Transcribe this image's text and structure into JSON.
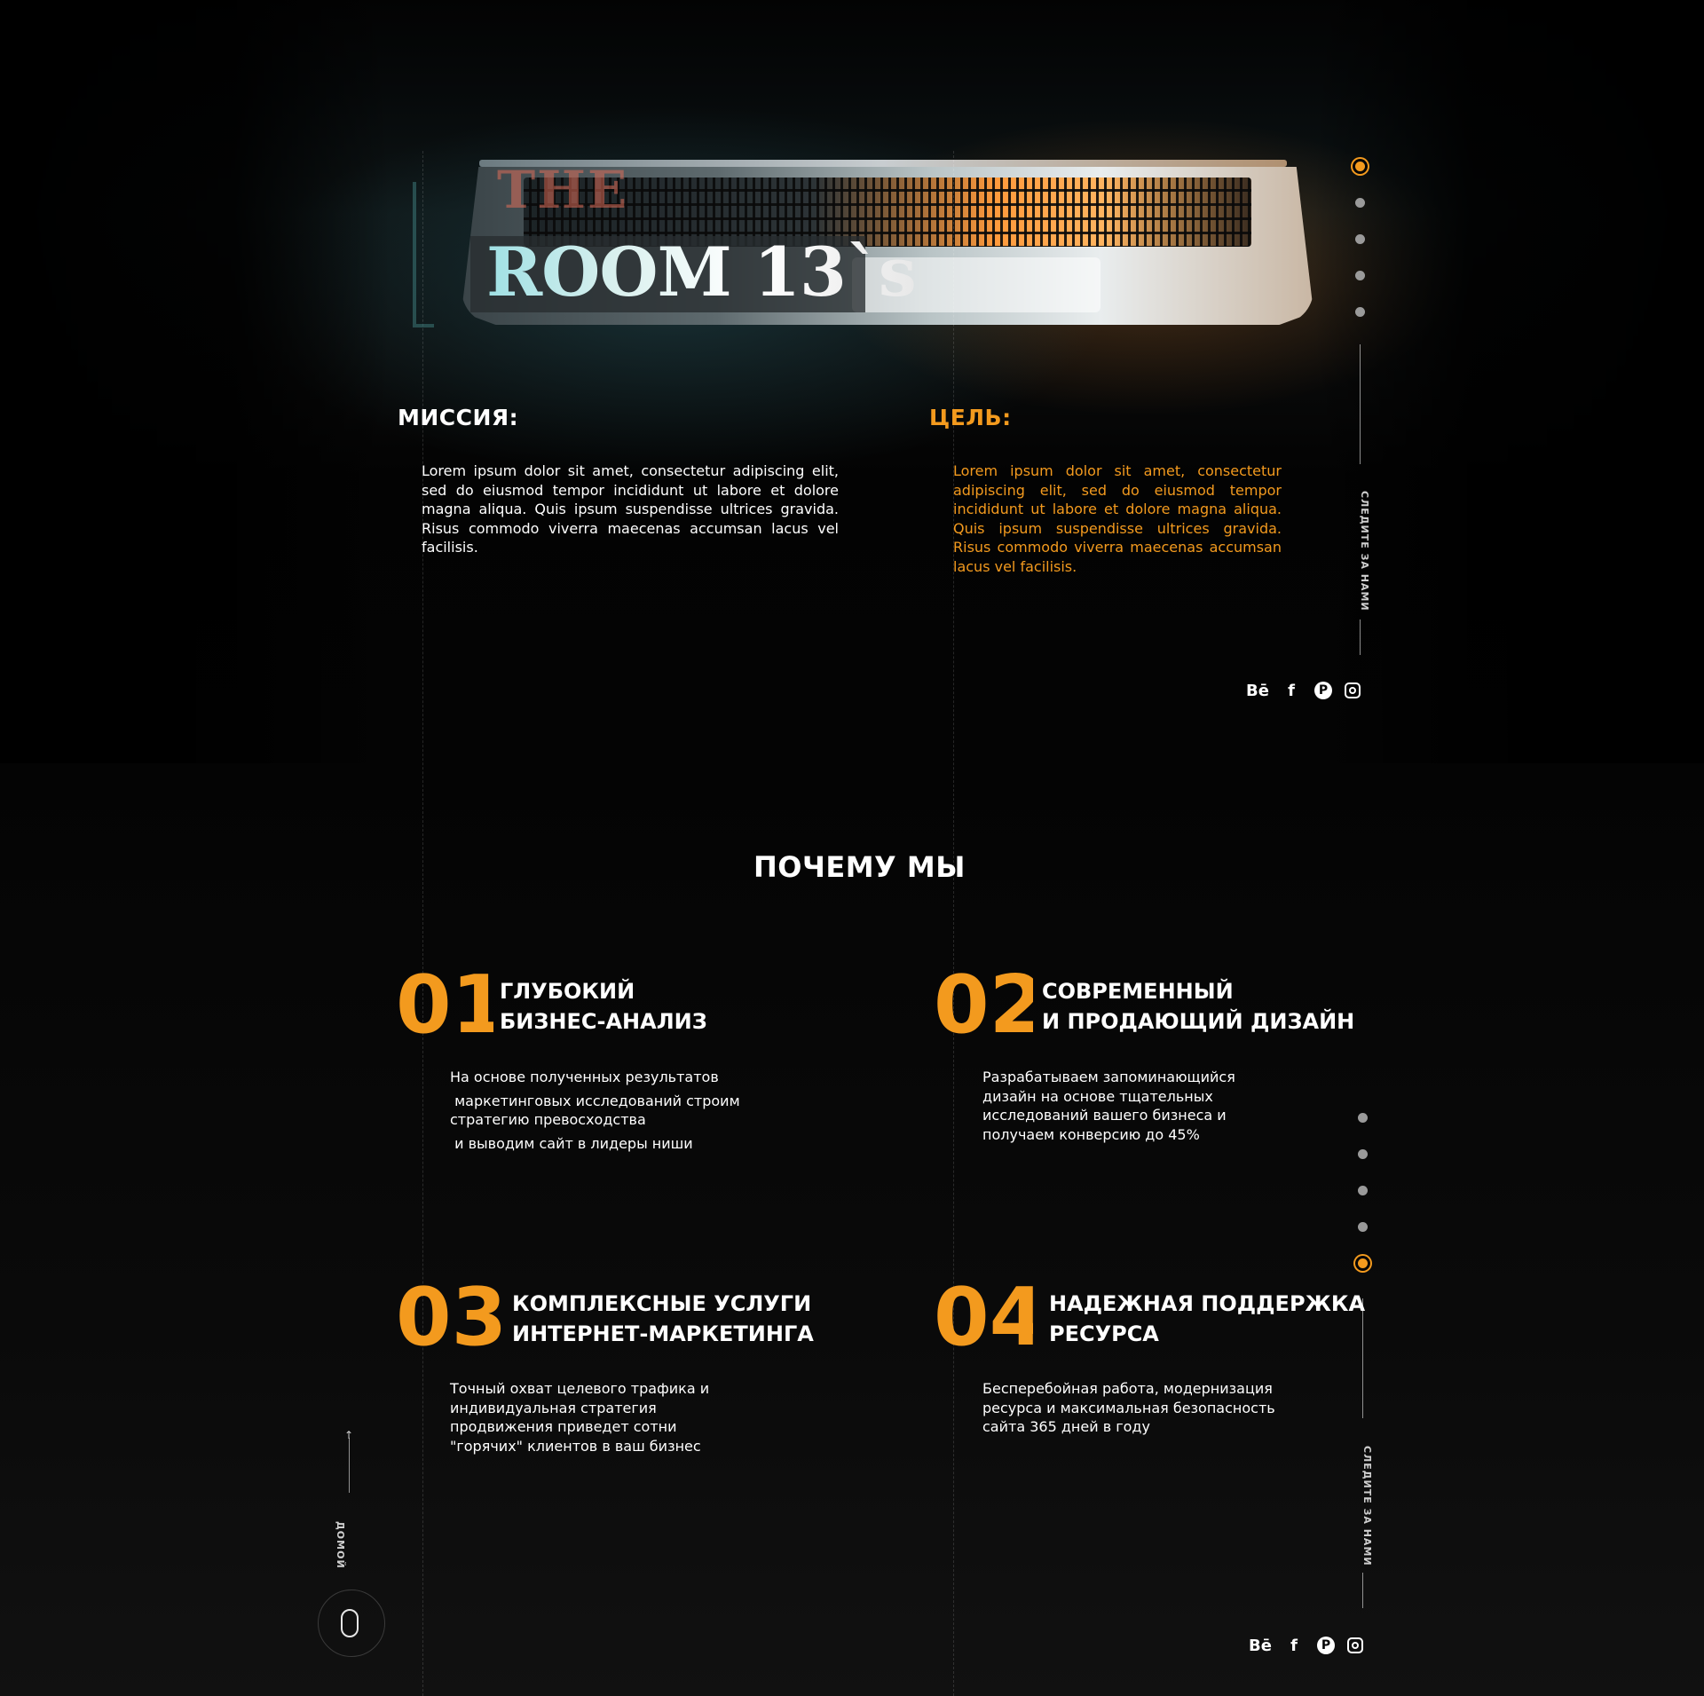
{
  "brand": {
    "prefix": "THE",
    "title": "ROOM 13`s"
  },
  "mission": {
    "title": "МИССИЯ:",
    "text": "Lorem ipsum dolor sit amet, consectetur adipiscing elit, sed do eiusmod tempor incididunt ut labore et dolore magna aliqua. Quis ipsum suspendisse ultrices gravida. Risus commodo viverra maecenas accumsan lacus vel facilisis."
  },
  "goal": {
    "title": "ЦЕЛЬ:",
    "text": "Lorem ipsum dolor sit amet, consectetur adipiscing elit, sed do eiusmod tempor incididunt ut labore et dolore magna aliqua. Quis ipsum suspendisse ultrices gravida. Risus commodo viverra maecenas accumsan lacus vel facilisis."
  },
  "follow_label": "СЛЕДИТЕ ЗА НАМИ",
  "social": {
    "behance": "Bē",
    "facebook": "f",
    "pinterest": "P"
  },
  "why": {
    "title": "ПОЧЕМУ МЫ",
    "items": [
      {
        "num": "01",
        "head1": "ГЛУБОКИЙ",
        "head2": "БИЗНЕС-АНАЛИЗ",
        "line1": "На основе полученных результатов",
        "line2": " маркетинговых исследований строим",
        "line3": "стратегию превосходства",
        "line4": " и выводим сайт в лидеры ниши"
      },
      {
        "num": "02",
        "head1": "СОВРЕМЕННЫЙ",
        "head2": "И ПРОДАЮЩИЙ ДИЗАЙН",
        "line1": "Разрабатываем запоминающийся",
        "line2": "дизайн на основе тщательных",
        "line3": "исследований вашего бизнеса и",
        "line4": "получаем конверсию до 45%"
      },
      {
        "num": "03",
        "head1": "КОМПЛЕКСНЫЕ УСЛУГИ",
        "head2": "ИНТЕРНЕТ-МАРКЕТИНГА",
        "line1": "Точный охват целевого трафика и",
        "line2": "индивидуальная стратегия",
        "line3": "продвижения приведет сотни",
        "line4": "\"горячих\" клиентов в ваш бизнес"
      },
      {
        "num": "04",
        "head1": "НАДЕЖНАЯ ПОДДЕРЖКА",
        "head2": "РЕСУРСА",
        "line1": "Бесперебойная работа, модернизация",
        "line2": "ресурса и максимальная безопасность",
        "line3": "сайта 365 дней в году"
      }
    ]
  },
  "home_label": "ДОМОЙ",
  "arrow_up": "↑",
  "colors": {
    "accent": "#f39a1e",
    "background": "#050505",
    "text": "#ffffff"
  }
}
